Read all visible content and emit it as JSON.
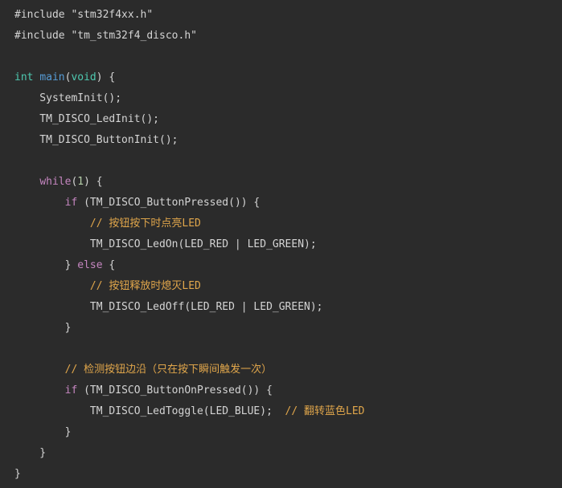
{
  "lines": [
    {
      "parts": [
        {
          "t": "#include \"stm32f4xx.h\"",
          "c": "id"
        }
      ]
    },
    {
      "parts": [
        {
          "t": "#include \"tm_stm32f4_disco.h\"",
          "c": "id"
        }
      ]
    },
    {
      "parts": []
    },
    {
      "parts": [
        {
          "t": "int",
          "c": "type"
        },
        {
          "t": " ",
          "c": "id"
        },
        {
          "t": "main",
          "c": "fn"
        },
        {
          "t": "(",
          "c": "id"
        },
        {
          "t": "void",
          "c": "type"
        },
        {
          "t": ") {",
          "c": "id"
        }
      ]
    },
    {
      "parts": [
        {
          "t": "    SystemInit();",
          "c": "id"
        }
      ]
    },
    {
      "parts": [
        {
          "t": "    TM_DISCO_LedInit();",
          "c": "id"
        }
      ]
    },
    {
      "parts": [
        {
          "t": "    TM_DISCO_ButtonInit();",
          "c": "id"
        }
      ]
    },
    {
      "parts": []
    },
    {
      "parts": [
        {
          "t": "    ",
          "c": "id"
        },
        {
          "t": "while",
          "c": "kw"
        },
        {
          "t": "(",
          "c": "id"
        },
        {
          "t": "1",
          "c": "num"
        },
        {
          "t": ") {",
          "c": "id"
        }
      ]
    },
    {
      "parts": [
        {
          "t": "        ",
          "c": "id"
        },
        {
          "t": "if",
          "c": "kw"
        },
        {
          "t": " (TM_DISCO_ButtonPressed()) {",
          "c": "id"
        }
      ]
    },
    {
      "parts": [
        {
          "t": "            ",
          "c": "id"
        },
        {
          "t": "// 按钮按下时点亮LED",
          "c": "com"
        }
      ]
    },
    {
      "parts": [
        {
          "t": "            TM_DISCO_LedOn(LED_RED | LED_GREEN);",
          "c": "id"
        }
      ]
    },
    {
      "parts": [
        {
          "t": "        } ",
          "c": "id"
        },
        {
          "t": "else",
          "c": "kw"
        },
        {
          "t": " {",
          "c": "id"
        }
      ]
    },
    {
      "parts": [
        {
          "t": "            ",
          "c": "id"
        },
        {
          "t": "// 按钮释放时熄灭LED",
          "c": "com"
        }
      ]
    },
    {
      "parts": [
        {
          "t": "            TM_DISCO_LedOff(LED_RED | LED_GREEN);",
          "c": "id"
        }
      ]
    },
    {
      "parts": [
        {
          "t": "        }",
          "c": "id"
        }
      ]
    },
    {
      "parts": []
    },
    {
      "parts": [
        {
          "t": "        ",
          "c": "id"
        },
        {
          "t": "// 检测按钮边沿（只在按下瞬间触发一次）",
          "c": "com"
        }
      ]
    },
    {
      "parts": [
        {
          "t": "        ",
          "c": "id"
        },
        {
          "t": "if",
          "c": "kw"
        },
        {
          "t": " (TM_DISCO_ButtonOnPressed()) {",
          "c": "id"
        }
      ]
    },
    {
      "parts": [
        {
          "t": "            TM_DISCO_LedToggle(LED_BLUE);  ",
          "c": "id"
        },
        {
          "t": "// 翻转蓝色LED",
          "c": "com"
        }
      ]
    },
    {
      "parts": [
        {
          "t": "        }",
          "c": "id"
        }
      ]
    },
    {
      "parts": [
        {
          "t": "    }",
          "c": "id"
        }
      ]
    },
    {
      "parts": [
        {
          "t": "}",
          "c": "id"
        }
      ]
    }
  ],
  "colors": {
    "background": "#2b2b2b",
    "text": "#d4d4d4",
    "keyword": "#c586c0",
    "type": "#4ec9b0",
    "function": "#569cd6",
    "number": "#b5cea8",
    "comment": "#e0a64b"
  }
}
